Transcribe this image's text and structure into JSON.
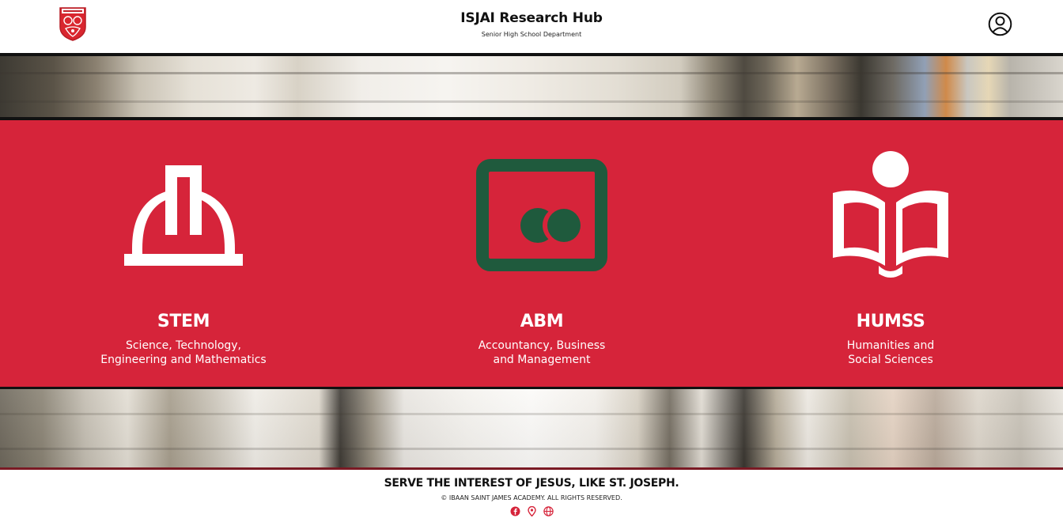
{
  "header": {
    "title": "ISJAI Research Hub",
    "subtitle": "Senior High School Department"
  },
  "icons": {
    "logo": "school-crest-icon",
    "profile": "user-circle-icon"
  },
  "programs": [
    {
      "name": "STEM",
      "description": "Science, Technology,\nEngineering and Mathematics",
      "icon": "hard-hat-icon",
      "icon_color": "#ffffff"
    },
    {
      "name": "ABM",
      "description": "Accountancy, Business\nand Management",
      "icon": "coins-board-icon",
      "icon_color": "#1f5a3d"
    },
    {
      "name": "HUMSS",
      "description": "Humanities and\nSocial Sciences",
      "icon": "reader-book-icon",
      "icon_color": "#ffffff"
    }
  ],
  "footer": {
    "motto": "SERVE THE INTEREST OF JESUS, LIKE ST. JOSEPH.",
    "copyright": "© IBAAN SAINT JAMES ACADEMY. ALL RIGHTS RESERVED.",
    "social_icons": [
      "facebook-icon",
      "location-pin-icon",
      "globe-icon"
    ]
  },
  "colors": {
    "brand_red": "#d6243a",
    "abm_green": "#1f5a3d",
    "dark_line": "#111111",
    "footer_icon_red": "#d6243a"
  }
}
